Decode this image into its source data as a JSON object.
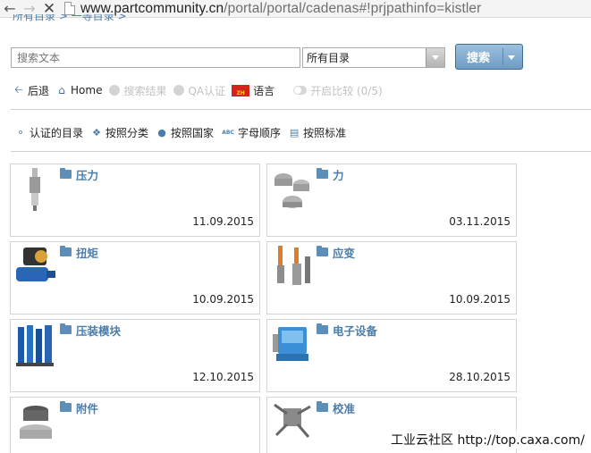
{
  "browser": {
    "url_host": "www.partcommunity.cn",
    "url_path": "/portal/portal/cadenas#!prjpathinfo=kistler"
  },
  "breadcrumb_cut": "所有目录 > 一等目录 >",
  "search": {
    "placeholder": "搜索文本",
    "catalog_selected": "所有目录",
    "button_label": "搜索"
  },
  "toolbar": {
    "back": "后退",
    "home": "Home",
    "results": "搜索结果",
    "qa": "QA认证",
    "flag_text": "ZH",
    "language": "语言",
    "compare": "开启比较 (0/5)"
  },
  "categories": {
    "certified": "认证的目录",
    "by_category": "按照分类",
    "by_country": "按照国家",
    "abc_text": "ABC",
    "alphabetical": "字母顺序",
    "by_standard": "按照标准"
  },
  "tiles": [
    {
      "title": "压力",
      "date": "11.09.2015"
    },
    {
      "title": "力",
      "date": "03.11.2015"
    },
    {
      "title": "扭矩",
      "date": "10.09.2015"
    },
    {
      "title": "应变",
      "date": "10.09.2015"
    },
    {
      "title": "压装模块",
      "date": "12.10.2015"
    },
    {
      "title": "电子设备",
      "date": "28.10.2015"
    },
    {
      "title": "附件",
      "date": ""
    },
    {
      "title": "校准",
      "date": ""
    }
  ],
  "watermark": "工业云社区 http://top.caxa.com/",
  "colors": {
    "accent": "#4b7dab",
    "button": "#7fa8cd"
  }
}
